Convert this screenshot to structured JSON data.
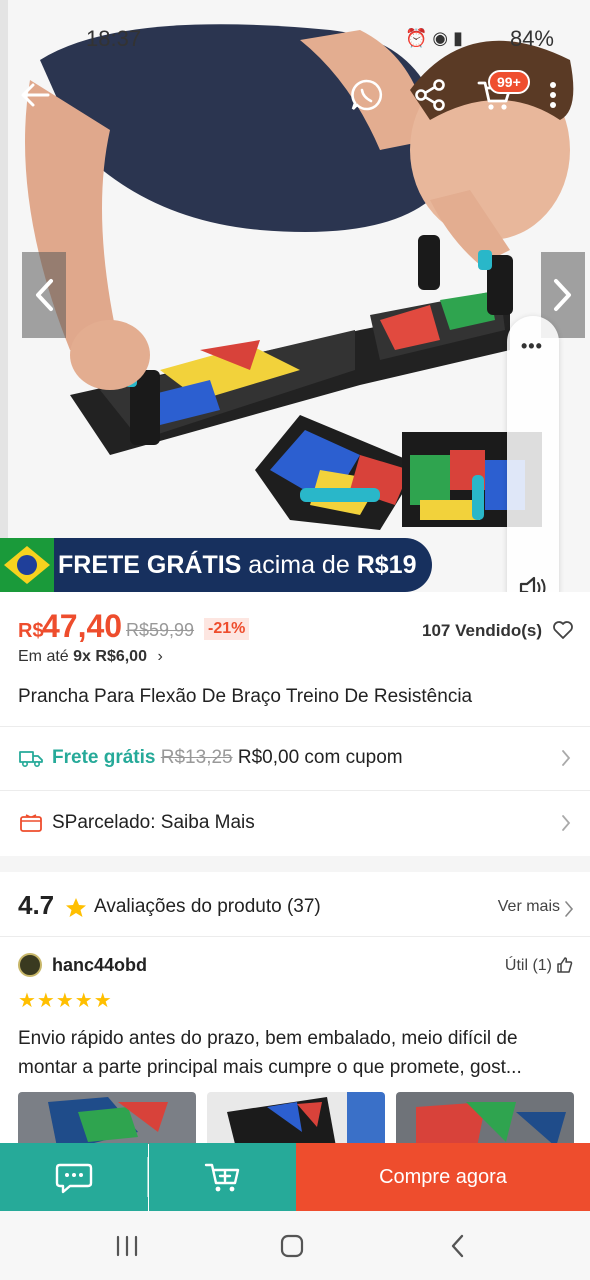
{
  "status_bar": {
    "time": "18:37",
    "battery": "84%"
  },
  "header": {
    "cart_badge": "99+"
  },
  "hero": {
    "image_desc_icon": "product-photo"
  },
  "banner": {
    "text_bold": "FRETE GRÁTIS",
    "text_light": "acima de",
    "text_amount": "R$19"
  },
  "price": {
    "currency": "R$",
    "current": "47,40",
    "original": "R$59,99",
    "discount": "-21%",
    "sold": "107 Vendido(s)",
    "installment_prefix": "Em até",
    "installment_bold": "9x R$6,00",
    "installment_chev": "›"
  },
  "product": {
    "title": "Prancha Para Flexão De Braço Treino De Resistência"
  },
  "shipping": {
    "label": "Frete grátis",
    "old_price": "R$13,25",
    "new_price": "R$0,00 com cupom"
  },
  "installment_row": {
    "label": "SParcelado: Saiba Mais"
  },
  "rating": {
    "score": "4.7",
    "label": "Avaliações do produto (37)",
    "see_more": "Ver mais"
  },
  "review": {
    "username": "hanc44obd",
    "useful": "Útil (1)",
    "stars": "★★★★★",
    "text": "Envio rápido antes do prazo, bem embalado, meio difícil de montar a parte principal mais cumpre o que promete, gost..."
  },
  "bottom_bar": {
    "buy_label": "Compre agora"
  },
  "colors": {
    "brand_orange": "#ee4d2d",
    "teal": "#26aa99",
    "navy_banner": "#17305e"
  }
}
